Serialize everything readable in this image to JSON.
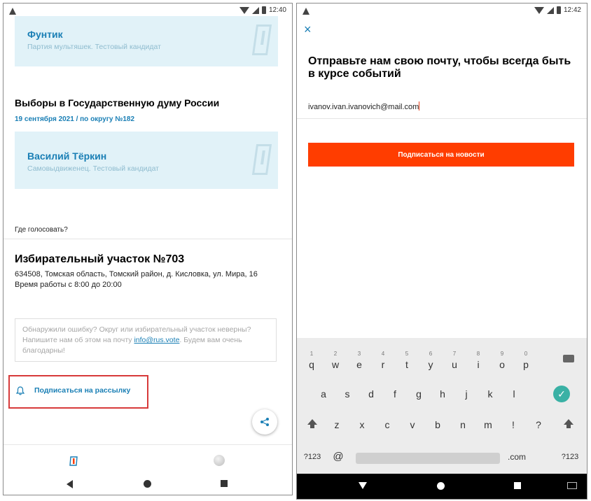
{
  "left_screen": {
    "status": {
      "time": "12:40"
    },
    "candidate_top": {
      "name": "Фунтик",
      "description": "Партия мультяшек. Тестовый кандидат"
    },
    "election": {
      "title": "Выборы в Государственную думу России",
      "date_line": "19 сентября 2021 / по округу №182"
    },
    "candidate_2": {
      "name": "Василий Тёркин",
      "description": "Самовыдвиженец. Тестовый кандидат"
    },
    "where_to_vote": "Где голосовать?",
    "polling_station": {
      "title": "Избирательный участок №703",
      "address": "634508, Томская область, Томский район, д. Кисловка, ул. Мира, 16",
      "hours": "Время работы с 8:00 до 20:00"
    },
    "error_notice": {
      "text_before": "Обнаружили ошибку? Округ или избирательный участок неверны? Напишите нам об этом на почту ",
      "email": "info@rus.vote",
      "text_after": ". Будем вам очень благодарны!"
    },
    "subscribe_label": "Подписаться на рассылку",
    "icons": {
      "share": "share-icon",
      "bell": "bell-icon",
      "logo": "app-logo-icon",
      "globe": "globe-icon"
    },
    "colors": {
      "accent": "#1a7fb5",
      "card_bg": "#e1f2f8",
      "highlight": "#d73a3a"
    }
  },
  "right_screen": {
    "status": {
      "time": "12:42"
    },
    "close_symbol": "×",
    "title": "Отправьте нам свою почту, чтобы всегда быть в курсе событий",
    "email_value": "ivanov.ivan.ivanovich@mail.com",
    "submit_label": "Подписаться на новости",
    "keyboard": {
      "row1": [
        {
          "k": "q",
          "n": "1"
        },
        {
          "k": "w",
          "n": "2"
        },
        {
          "k": "e",
          "n": "3"
        },
        {
          "k": "r",
          "n": "4"
        },
        {
          "k": "t",
          "n": "5"
        },
        {
          "k": "y",
          "n": "6"
        },
        {
          "k": "u",
          "n": "7"
        },
        {
          "k": "i",
          "n": "8"
        },
        {
          "k": "o",
          "n": "9"
        },
        {
          "k": "p",
          "n": "0"
        }
      ],
      "row2": [
        "a",
        "s",
        "d",
        "f",
        "g",
        "h",
        "j",
        "k",
        "l"
      ],
      "row3": [
        "z",
        "x",
        "c",
        "v",
        "b",
        "n",
        "m",
        "!",
        "?"
      ],
      "sym_label": "?123",
      "at_label": "@",
      "dotcom_label": ".com",
      "sym_label_right": "?123"
    },
    "colors": {
      "submit_bg": "#ff3d00",
      "enter_key": "#3ab1a5"
    }
  }
}
